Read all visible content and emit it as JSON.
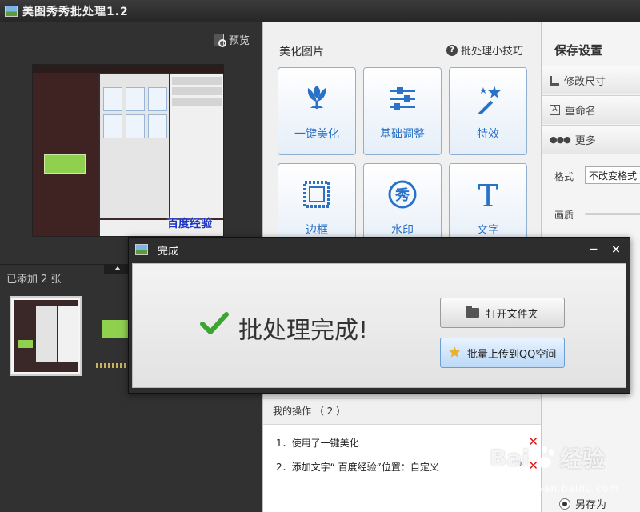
{
  "app": {
    "title": "美图秀秀批处理1.2"
  },
  "left": {
    "preview_label": "预览",
    "added_count": "已添加 2 张",
    "thumb_watermark": "百度经验"
  },
  "beautify": {
    "title": "美化图片",
    "tips": "批处理小技巧",
    "tools": [
      {
        "label": "一键美化",
        "icon": "tulip-icon"
      },
      {
        "label": "基础调整",
        "icon": "sliders-icon"
      },
      {
        "label": "特效",
        "icon": "magic-wand-icon"
      },
      {
        "label": "边框",
        "icon": "frame-icon"
      },
      {
        "label": "水印",
        "icon": "watermark-icon"
      },
      {
        "label": "文字",
        "icon": "text-icon"
      }
    ],
    "tool_icon_glyphs": {
      "watermark": "秀",
      "text": "T"
    }
  },
  "operations": {
    "header": "我的操作 （ 2 ）",
    "items": [
      "1．使用了一键美化",
      "2．添加文字“  百度经验”位置：自定义"
    ]
  },
  "save_settings": {
    "title": "保存设置",
    "resize": "修改尺寸",
    "rename": "重命名",
    "more": "更多",
    "format_label": "格式",
    "format_value": "不改变格式",
    "quality_label": "画质",
    "save_as": "另存为"
  },
  "dialog": {
    "title": "完成",
    "message": "批处理完成!",
    "open_folder": "打开文件夹",
    "upload": "批量上传到QQ空间",
    "minimize": "−",
    "close": "×"
  },
  "watermark": {
    "brand": "Bai",
    "brand2": "经验",
    "url": "jingyan.baidu.com"
  },
  "colors": {
    "accent": "#2a72c8",
    "check_green": "#3aa62e",
    "delete_red": "#dd1111"
  }
}
